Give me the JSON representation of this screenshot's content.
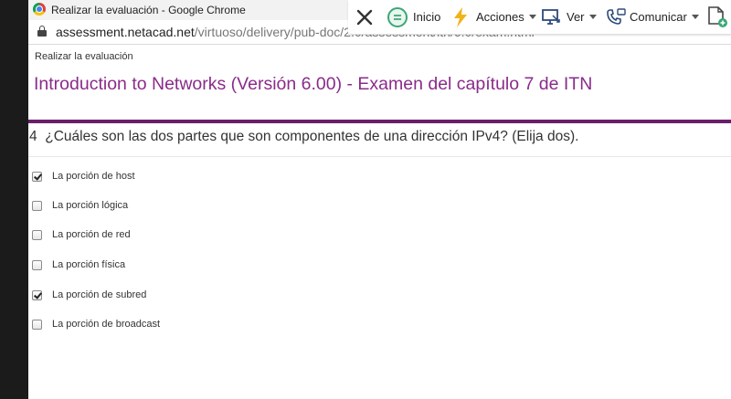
{
  "window": {
    "title": "Realizar la evaluación - Google Chrome"
  },
  "address": {
    "host": "assessment.netacad.net",
    "path": "/virtuoso/delivery/pub-doc/2.0/assessment/itn/6.0/exam.html"
  },
  "toolbar": {
    "home_label": "Inicio",
    "actions_label": "Acciones",
    "view_label": "Ver",
    "communicate_label": "Comunicar"
  },
  "page": {
    "breadcrumb": "Realizar la evaluación",
    "title": "Introduction to Networks (Versión 6.00) - Examen del capítulo 7 de ITN"
  },
  "question": {
    "number": "4",
    "text": "¿Cuáles son las dos partes que son componentes de una dirección IPv4? (Elija dos).",
    "options": [
      {
        "label": "La porción de host",
        "checked": true
      },
      {
        "label": "La porción lógica",
        "checked": false
      },
      {
        "label": "La porción de red",
        "checked": false
      },
      {
        "label": "La porción física",
        "checked": false
      },
      {
        "label": "La porción de subred",
        "checked": true
      },
      {
        "label": "La porción de broadcast",
        "checked": false
      }
    ]
  },
  "colors": {
    "title_purple": "#8a2b8a",
    "bar_purple": "#6b1e6b",
    "actions_icon": "#f2b21a",
    "home_icon": "#3aa776"
  }
}
